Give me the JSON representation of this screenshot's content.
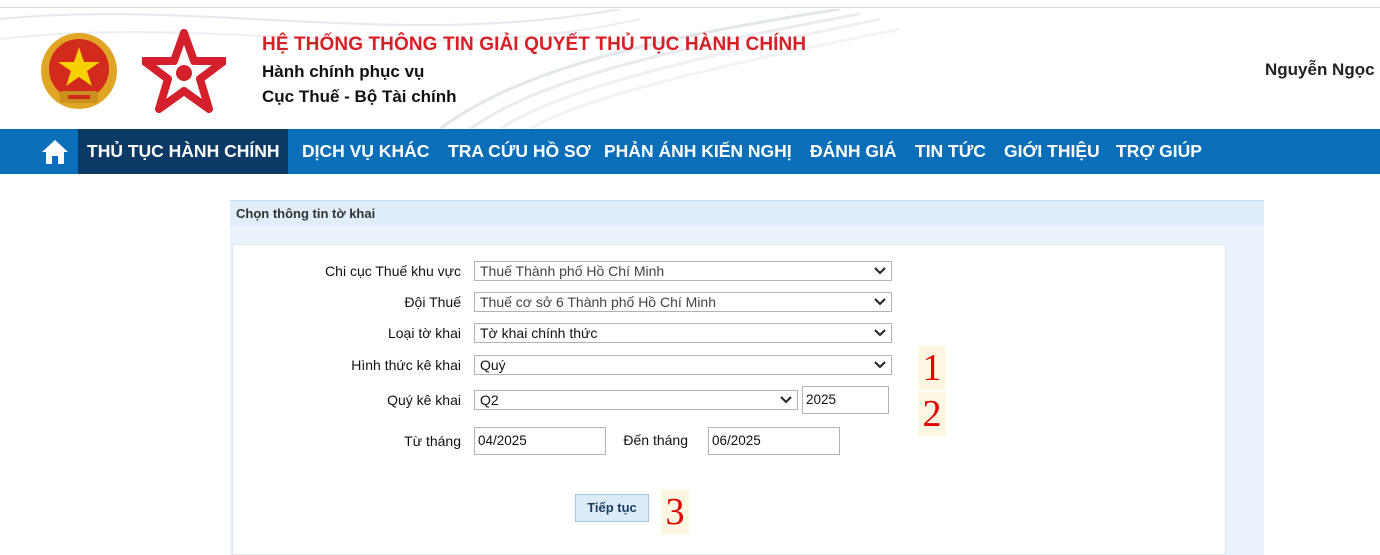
{
  "header": {
    "system_title": "HỆ THỐNG THÔNG TIN GIẢI QUYẾT THỦ TỤC HÀNH CHÍNH",
    "subtitle_1": "Hành chính phục vụ",
    "subtitle_2": "Cục Thuế - Bộ Tài chính",
    "user_name": "Nguyễn Ngọc",
    "colors": {
      "title_red": "#d71f26",
      "nav_blue": "#0a6fb8",
      "nav_active": "#0b3a66"
    }
  },
  "nav": {
    "home_icon": "home-icon",
    "items": [
      {
        "label": "THỦ TỤC HÀNH CHÍNH",
        "active": true
      },
      {
        "label": "DỊCH VỤ KHÁC"
      },
      {
        "label": "TRA CỨU HỒ SƠ"
      },
      {
        "label": "PHẢN ÁNH KIẾN NGHỊ"
      },
      {
        "label": "ĐÁNH GIÁ"
      },
      {
        "label": "TIN TỨC"
      },
      {
        "label": "GIỚI THIỆU"
      },
      {
        "label": "TRỢ GIÚP"
      }
    ]
  },
  "form": {
    "panel_title": "Chọn thông tin tờ khai",
    "fields": {
      "chi_cuc": {
        "label": "Chi cục Thuế khu vực",
        "value": "Thuế Thành phố Hồ Chí Minh"
      },
      "doi_thue": {
        "label": "Đội Thuế",
        "value": "Thuế cơ sở 6 Thành phố Hồ Chí Minh"
      },
      "loai_to_khai": {
        "label": "Loại tờ khai",
        "value": "Tờ khai chính thức"
      },
      "hinh_thuc": {
        "label": "Hình thức kê khai",
        "value": "Quý"
      },
      "quy_ke_khai": {
        "label": "Quý kê khai",
        "value": "Q2",
        "year": "2025"
      },
      "tu_thang": {
        "label": "Từ tháng",
        "value": "04/2025"
      },
      "den_thang": {
        "label": "Đến tháng",
        "value": "06/2025"
      }
    },
    "continue_label": "Tiếp tục"
  },
  "annotations": [
    "1",
    "2",
    "3"
  ]
}
